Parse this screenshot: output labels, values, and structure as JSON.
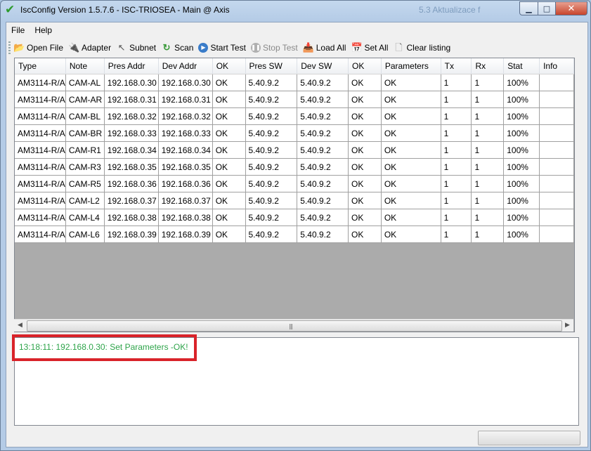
{
  "window": {
    "title": "IscConfig Version 1.5.7.6 - ISC-TRIOSEA - Main @ Axis",
    "background_text": "5.3    Aktualizace f",
    "buttons": {
      "minimize": "▁",
      "maximize": "□",
      "close": "✕"
    }
  },
  "menu": [
    "File",
    "Help"
  ],
  "toolbar": [
    {
      "label": "Open File",
      "icon": "folder-icon",
      "glyph": "📂",
      "enabled": true
    },
    {
      "label": "Adapter",
      "icon": "plug-icon",
      "glyph": "🔌",
      "enabled": true
    },
    {
      "label": "Subnet",
      "icon": "cursor-icon",
      "glyph": "↖",
      "enabled": true
    },
    {
      "label": "Scan",
      "icon": "refresh-icon",
      "glyph": "↻",
      "enabled": true
    },
    {
      "label": "Start Test",
      "icon": "play-icon",
      "glyph": "▶",
      "enabled": true
    },
    {
      "label": "Stop Test",
      "icon": "pause-icon",
      "glyph": "❚❚",
      "enabled": false
    },
    {
      "label": "Load All",
      "icon": "load-icon",
      "glyph": "📥",
      "enabled": true
    },
    {
      "label": "Set All",
      "icon": "set-icon",
      "glyph": "📅",
      "enabled": true
    },
    {
      "label": "Clear listing",
      "icon": "clear-icon",
      "glyph": "🗋",
      "enabled": true
    }
  ],
  "grid": {
    "columns": [
      "Type",
      "Note",
      "Pres Addr",
      "Dev Addr",
      "OK",
      "Pres SW",
      "Dev SW",
      "OK",
      "Parameters",
      "Tx",
      "Rx",
      "Stat",
      "Info"
    ],
    "rows": [
      [
        "AM3114-R/A",
        "CAM-AL",
        "192.168.0.30",
        "192.168.0.30",
        "OK",
        "5.40.9.2",
        "5.40.9.2",
        "OK",
        "OK",
        "1",
        "1",
        "100%",
        ""
      ],
      [
        "AM3114-R/A",
        "CAM-AR",
        "192.168.0.31",
        "192.168.0.31",
        "OK",
        "5.40.9.2",
        "5.40.9.2",
        "OK",
        "OK",
        "1",
        "1",
        "100%",
        ""
      ],
      [
        "AM3114-R/A",
        "CAM-BL",
        "192.168.0.32",
        "192.168.0.32",
        "OK",
        "5.40.9.2",
        "5.40.9.2",
        "OK",
        "OK",
        "1",
        "1",
        "100%",
        ""
      ],
      [
        "AM3114-R/A",
        "CAM-BR",
        "192.168.0.33",
        "192.168.0.33",
        "OK",
        "5.40.9.2",
        "5.40.9.2",
        "OK",
        "OK",
        "1",
        "1",
        "100%",
        ""
      ],
      [
        "AM3114-R/A",
        "CAM-R1",
        "192.168.0.34",
        "192.168.0.34",
        "OK",
        "5.40.9.2",
        "5.40.9.2",
        "OK",
        "OK",
        "1",
        "1",
        "100%",
        ""
      ],
      [
        "AM3114-R/A",
        "CAM-R3",
        "192.168.0.35",
        "192.168.0.35",
        "OK",
        "5.40.9.2",
        "5.40.9.2",
        "OK",
        "OK",
        "1",
        "1",
        "100%",
        ""
      ],
      [
        "AM3114-R/A",
        "CAM-R5",
        "192.168.0.36",
        "192.168.0.36",
        "OK",
        "5.40.9.2",
        "5.40.9.2",
        "OK",
        "OK",
        "1",
        "1",
        "100%",
        ""
      ],
      [
        "AM3114-R/A",
        "CAM-L2",
        "192.168.0.37",
        "192.168.0.37",
        "OK",
        "5.40.9.2",
        "5.40.9.2",
        "OK",
        "OK",
        "1",
        "1",
        "100%",
        ""
      ],
      [
        "AM3114-R/A",
        "CAM-L4",
        "192.168.0.38",
        "192.168.0.38",
        "OK",
        "5.40.9.2",
        "5.40.9.2",
        "OK",
        "OK",
        "1",
        "1",
        "100%",
        ""
      ],
      [
        "AM3114-R/A",
        "CAM-L6",
        "192.168.0.39",
        "192.168.0.39",
        "OK",
        "5.40.9.2",
        "5.40.9.2",
        "OK",
        "OK",
        "1",
        "1",
        "100%",
        ""
      ]
    ]
  },
  "log": {
    "entries": [
      "13:18:11: 192.168.0.30: Set Parameters -OK!"
    ],
    "entry_color": "#2ea44a",
    "highlight_color": "#d9232a"
  },
  "app_icon": "check-icon"
}
